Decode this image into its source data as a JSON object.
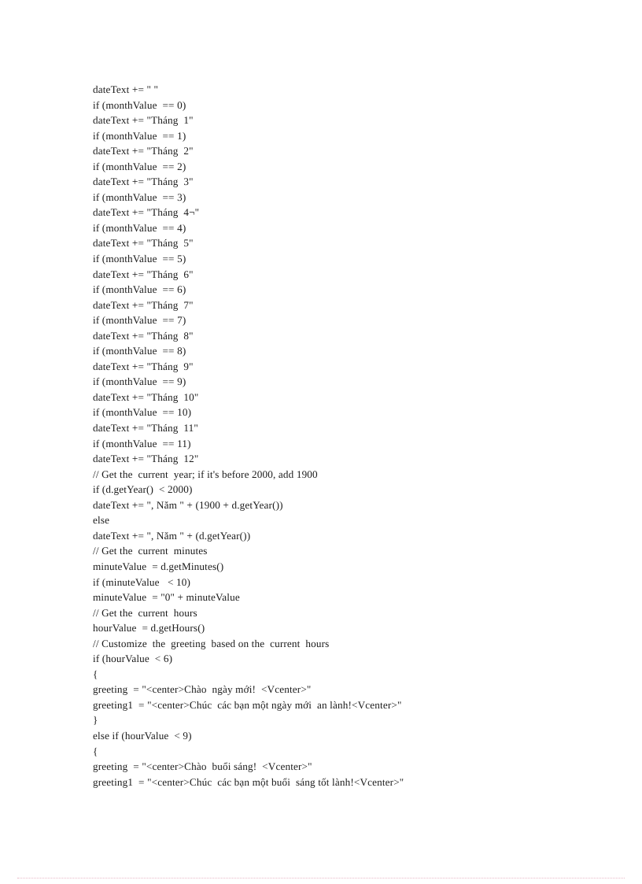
{
  "document": {
    "page_background": "#ffffff",
    "text_color": "#1a1a1a",
    "footer_rule_color": "#e8b9c8",
    "code_lines": [
      "dateText += \" \"",
      "if (monthValue  == 0)",
      "dateText += \"Tháng  1\"",
      "if (monthValue  == 1)",
      "dateText += \"Tháng  2\"",
      "if (monthValue  == 2)",
      "dateText += \"Tháng  3\"",
      "if (monthValue  == 3)",
      "dateText += \"Tháng  4¬\"",
      "if (monthValue  == 4)",
      "dateText += \"Tháng  5\"",
      "if (monthValue  == 5)",
      "dateText += \"Tháng  6\"",
      "if (monthValue  == 6)",
      "dateText += \"Tháng  7\"",
      "if (monthValue  == 7)",
      "dateText += \"Tháng  8\"",
      "if (monthValue  == 8)",
      "dateText += \"Tháng  9\"",
      "if (monthValue  == 9)",
      "dateText += \"Tháng  10\"",
      "if (monthValue  == 10)",
      "dateText += \"Tháng  11\"",
      "if (monthValue  == 11)",
      "dateText += \"Tháng  12\"",
      "// Get the  current  year; if it's before 2000, add 1900",
      "if (d.getYear()  < 2000)",
      "dateText += \", Năm \" + (1900 + d.getYear())",
      "else",
      "dateText += \", Năm \" + (d.getYear())",
      "// Get the  current  minutes",
      "minuteValue  = d.getMinutes()",
      "if (minuteValue   < 10)",
      "minuteValue  = \"0\" + minuteValue",
      "// Get the  current  hours",
      "hourValue  = d.getHours()",
      "// Customize  the  greeting  based on the  current  hours",
      "if (hourValue  < 6)",
      "{",
      "greeting  = \"<center>Chào  ngày mới!  <Vcenter>\"",
      "greeting1  = \"<center>Chúc  các bạn một ngày mới  an lành!<Vcenter>\"",
      "}",
      "else if (hourValue  < 9)",
      "{",
      "greeting  = \"<center>Chào  buổi sáng!  <Vcenter>\"",
      "greeting1  = \"<center>Chúc  các bạn một buổi  sáng tốt lành!<Vcenter>\""
    ]
  }
}
